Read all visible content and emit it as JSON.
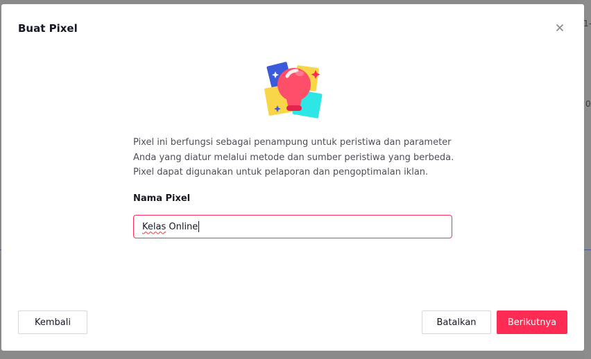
{
  "backdrop": {
    "fragment_top": "1-",
    "fragment_mid": "0"
  },
  "modal": {
    "title": "Buat Pixel",
    "description_lines": [
      "Pixel ini berfungsi sebagai penampung untuk peristiwa dan parameter",
      "Anda yang diatur melalui metode dan sumber peristiwa yang berbeda.",
      "Pixel dapat digunakan untuk pelaporan dan pengoptimalan iklan."
    ],
    "field_label": "Nama Pixel",
    "input": {
      "word1": "Kelas",
      "word2": " Online"
    },
    "buttons": {
      "back": "Kembali",
      "cancel": "Batalkan",
      "next": "Berikutnya"
    }
  },
  "colors": {
    "accent": "#fe2c55",
    "text_primary": "#161823",
    "text_secondary": "#4d4f57",
    "border": "#d6d7da"
  },
  "icons": {
    "close": "close-icon",
    "illustration": "lightbulb-illustration-icon"
  }
}
